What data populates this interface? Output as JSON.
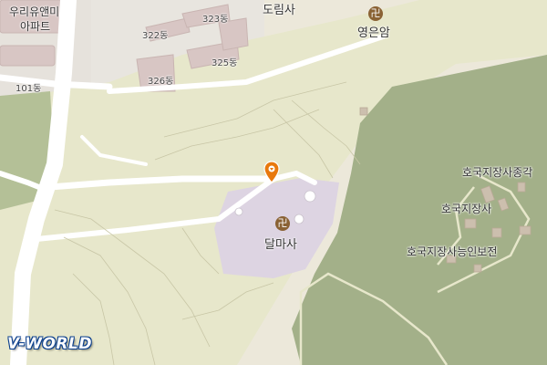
{
  "map": {
    "labels": {
      "apartment_top": "우리유앤미",
      "apartment_sub": "아파트",
      "bldg_101": "101동",
      "bldg_322": "322동",
      "bldg_323": "323동",
      "bldg_325": "325동",
      "bldg_326": "326동",
      "dorimsa": "도림사",
      "yeongeunam": "영은암",
      "dalmasa": "달마사",
      "hoguk_jongak": "호국지장사종각",
      "hoguk_jijangsa": "호국지장사",
      "hoguk_boseon": "호국지장사능인보전"
    },
    "icons": {
      "temple_glyph": "卍",
      "temple_color": "#8a6234",
      "pin_color": "#e8780d"
    },
    "colors": {
      "land": "#ece8da",
      "park_green": "#b4c097",
      "forest_green": "#a3b089",
      "temple_grounds": "#ddd4e2",
      "road": "#ffffff",
      "building": "#d8c6c4"
    }
  },
  "logo": {
    "text": "V-WORLD"
  }
}
